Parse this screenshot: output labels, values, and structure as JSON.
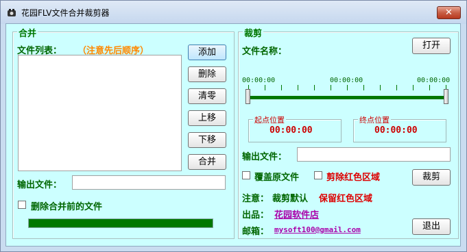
{
  "window": {
    "title": "花园FLV文件合并裁剪器",
    "close_glyph": "✕"
  },
  "merge": {
    "group_title": "合并",
    "file_list_label": "文件列表：",
    "order_note": "（注意先后顺序）",
    "buttons": {
      "add": "添加",
      "delete": "删除",
      "clear": "清零",
      "move_up": "上移",
      "move_down": "下移",
      "merge": "合并"
    },
    "output_label": "输出文件：",
    "output_value": "",
    "delete_before_label": "删除合并前的文件",
    "delete_before_checked": false,
    "progress": 1.0
  },
  "cut": {
    "group_title": "裁剪",
    "file_name_label": "文件名称：",
    "open_button": "打开",
    "slider_times": {
      "left": "00:00:00",
      "middle": "00:00:00",
      "right": "00:00:00"
    },
    "start_box": {
      "title": "起点位置",
      "value": "00:00:00"
    },
    "end_box": {
      "title": "终点位置",
      "value": "00:00:00"
    },
    "output_label": "输出文件：",
    "output_value": "",
    "overwrite_label": "覆盖原文件",
    "overwrite_checked": false,
    "remove_red_label": "剪除红色区域",
    "remove_red_checked": false,
    "cut_button": "裁剪",
    "note_prefix": "注意：",
    "note_default": "裁剪默认",
    "note_keep": "保留红色区域",
    "producer_label": "出品：",
    "producer_link": "花园软件店",
    "email_label": "邮箱：",
    "email_link": "mysoft100@gmail.com",
    "exit_button": "退出"
  },
  "colors": {
    "accent_green": "#006600",
    "client_bg": "#ccffff",
    "warning_red": "#dd0000",
    "note_orange": "#ff8800"
  }
}
